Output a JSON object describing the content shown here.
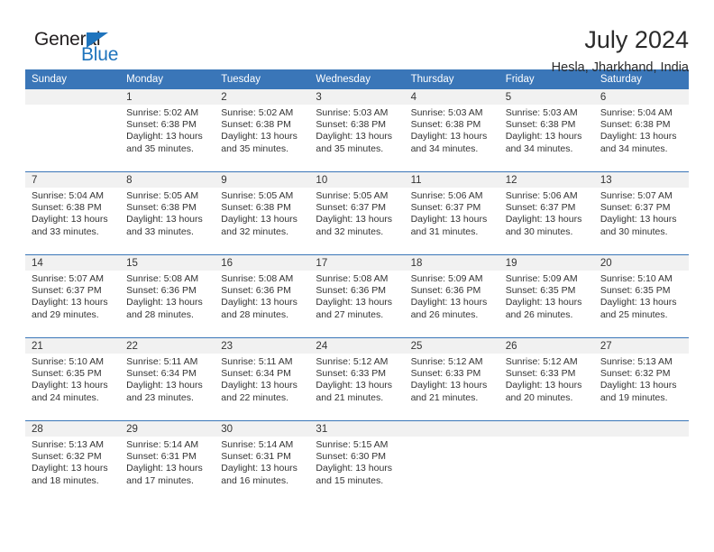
{
  "brand": {
    "name_part1": "General",
    "name_part2": "Blue",
    "triangle_color": "#1f74bd"
  },
  "header": {
    "title": "July 2024",
    "location": "Hesla, Jharkhand, India"
  },
  "theme": {
    "header_blue": "#3a76b8",
    "band_gray": "#f1f1f1",
    "text": "#333333"
  },
  "weekdays": [
    "Sunday",
    "Monday",
    "Tuesday",
    "Wednesday",
    "Thursday",
    "Friday",
    "Saturday"
  ],
  "labels": {
    "sunrise_prefix": "Sunrise:",
    "sunset_prefix": "Sunset:",
    "daylight_prefix": "Daylight:"
  },
  "weeks": [
    [
      {
        "day": "",
        "line1": "",
        "line2": "",
        "line3": "",
        "line4": ""
      },
      {
        "day": "1",
        "line1": "Sunrise: 5:02 AM",
        "line2": "Sunset: 6:38 PM",
        "line3": "Daylight: 13 hours",
        "line4": "and 35 minutes."
      },
      {
        "day": "2",
        "line1": "Sunrise: 5:02 AM",
        "line2": "Sunset: 6:38 PM",
        "line3": "Daylight: 13 hours",
        "line4": "and 35 minutes."
      },
      {
        "day": "3",
        "line1": "Sunrise: 5:03 AM",
        "line2": "Sunset: 6:38 PM",
        "line3": "Daylight: 13 hours",
        "line4": "and 35 minutes."
      },
      {
        "day": "4",
        "line1": "Sunrise: 5:03 AM",
        "line2": "Sunset: 6:38 PM",
        "line3": "Daylight: 13 hours",
        "line4": "and 34 minutes."
      },
      {
        "day": "5",
        "line1": "Sunrise: 5:03 AM",
        "line2": "Sunset: 6:38 PM",
        "line3": "Daylight: 13 hours",
        "line4": "and 34 minutes."
      },
      {
        "day": "6",
        "line1": "Sunrise: 5:04 AM",
        "line2": "Sunset: 6:38 PM",
        "line3": "Daylight: 13 hours",
        "line4": "and 34 minutes."
      }
    ],
    [
      {
        "day": "7",
        "line1": "Sunrise: 5:04 AM",
        "line2": "Sunset: 6:38 PM",
        "line3": "Daylight: 13 hours",
        "line4": "and 33 minutes."
      },
      {
        "day": "8",
        "line1": "Sunrise: 5:05 AM",
        "line2": "Sunset: 6:38 PM",
        "line3": "Daylight: 13 hours",
        "line4": "and 33 minutes."
      },
      {
        "day": "9",
        "line1": "Sunrise: 5:05 AM",
        "line2": "Sunset: 6:38 PM",
        "line3": "Daylight: 13 hours",
        "line4": "and 32 minutes."
      },
      {
        "day": "10",
        "line1": "Sunrise: 5:05 AM",
        "line2": "Sunset: 6:37 PM",
        "line3": "Daylight: 13 hours",
        "line4": "and 32 minutes."
      },
      {
        "day": "11",
        "line1": "Sunrise: 5:06 AM",
        "line2": "Sunset: 6:37 PM",
        "line3": "Daylight: 13 hours",
        "line4": "and 31 minutes."
      },
      {
        "day": "12",
        "line1": "Sunrise: 5:06 AM",
        "line2": "Sunset: 6:37 PM",
        "line3": "Daylight: 13 hours",
        "line4": "and 30 minutes."
      },
      {
        "day": "13",
        "line1": "Sunrise: 5:07 AM",
        "line2": "Sunset: 6:37 PM",
        "line3": "Daylight: 13 hours",
        "line4": "and 30 minutes."
      }
    ],
    [
      {
        "day": "14",
        "line1": "Sunrise: 5:07 AM",
        "line2": "Sunset: 6:37 PM",
        "line3": "Daylight: 13 hours",
        "line4": "and 29 minutes."
      },
      {
        "day": "15",
        "line1": "Sunrise: 5:08 AM",
        "line2": "Sunset: 6:36 PM",
        "line3": "Daylight: 13 hours",
        "line4": "and 28 minutes."
      },
      {
        "day": "16",
        "line1": "Sunrise: 5:08 AM",
        "line2": "Sunset: 6:36 PM",
        "line3": "Daylight: 13 hours",
        "line4": "and 28 minutes."
      },
      {
        "day": "17",
        "line1": "Sunrise: 5:08 AM",
        "line2": "Sunset: 6:36 PM",
        "line3": "Daylight: 13 hours",
        "line4": "and 27 minutes."
      },
      {
        "day": "18",
        "line1": "Sunrise: 5:09 AM",
        "line2": "Sunset: 6:36 PM",
        "line3": "Daylight: 13 hours",
        "line4": "and 26 minutes."
      },
      {
        "day": "19",
        "line1": "Sunrise: 5:09 AM",
        "line2": "Sunset: 6:35 PM",
        "line3": "Daylight: 13 hours",
        "line4": "and 26 minutes."
      },
      {
        "day": "20",
        "line1": "Sunrise: 5:10 AM",
        "line2": "Sunset: 6:35 PM",
        "line3": "Daylight: 13 hours",
        "line4": "and 25 minutes."
      }
    ],
    [
      {
        "day": "21",
        "line1": "Sunrise: 5:10 AM",
        "line2": "Sunset: 6:35 PM",
        "line3": "Daylight: 13 hours",
        "line4": "and 24 minutes."
      },
      {
        "day": "22",
        "line1": "Sunrise: 5:11 AM",
        "line2": "Sunset: 6:34 PM",
        "line3": "Daylight: 13 hours",
        "line4": "and 23 minutes."
      },
      {
        "day": "23",
        "line1": "Sunrise: 5:11 AM",
        "line2": "Sunset: 6:34 PM",
        "line3": "Daylight: 13 hours",
        "line4": "and 22 minutes."
      },
      {
        "day": "24",
        "line1": "Sunrise: 5:12 AM",
        "line2": "Sunset: 6:33 PM",
        "line3": "Daylight: 13 hours",
        "line4": "and 21 minutes."
      },
      {
        "day": "25",
        "line1": "Sunrise: 5:12 AM",
        "line2": "Sunset: 6:33 PM",
        "line3": "Daylight: 13 hours",
        "line4": "and 21 minutes."
      },
      {
        "day": "26",
        "line1": "Sunrise: 5:12 AM",
        "line2": "Sunset: 6:33 PM",
        "line3": "Daylight: 13 hours",
        "line4": "and 20 minutes."
      },
      {
        "day": "27",
        "line1": "Sunrise: 5:13 AM",
        "line2": "Sunset: 6:32 PM",
        "line3": "Daylight: 13 hours",
        "line4": "and 19 minutes."
      }
    ],
    [
      {
        "day": "28",
        "line1": "Sunrise: 5:13 AM",
        "line2": "Sunset: 6:32 PM",
        "line3": "Daylight: 13 hours",
        "line4": "and 18 minutes."
      },
      {
        "day": "29",
        "line1": "Sunrise: 5:14 AM",
        "line2": "Sunset: 6:31 PM",
        "line3": "Daylight: 13 hours",
        "line4": "and 17 minutes."
      },
      {
        "day": "30",
        "line1": "Sunrise: 5:14 AM",
        "line2": "Sunset: 6:31 PM",
        "line3": "Daylight: 13 hours",
        "line4": "and 16 minutes."
      },
      {
        "day": "31",
        "line1": "Sunrise: 5:15 AM",
        "line2": "Sunset: 6:30 PM",
        "line3": "Daylight: 13 hours",
        "line4": "and 15 minutes."
      },
      {
        "day": "",
        "line1": "",
        "line2": "",
        "line3": "",
        "line4": ""
      },
      {
        "day": "",
        "line1": "",
        "line2": "",
        "line3": "",
        "line4": ""
      },
      {
        "day": "",
        "line1": "",
        "line2": "",
        "line3": "",
        "line4": ""
      }
    ]
  ]
}
